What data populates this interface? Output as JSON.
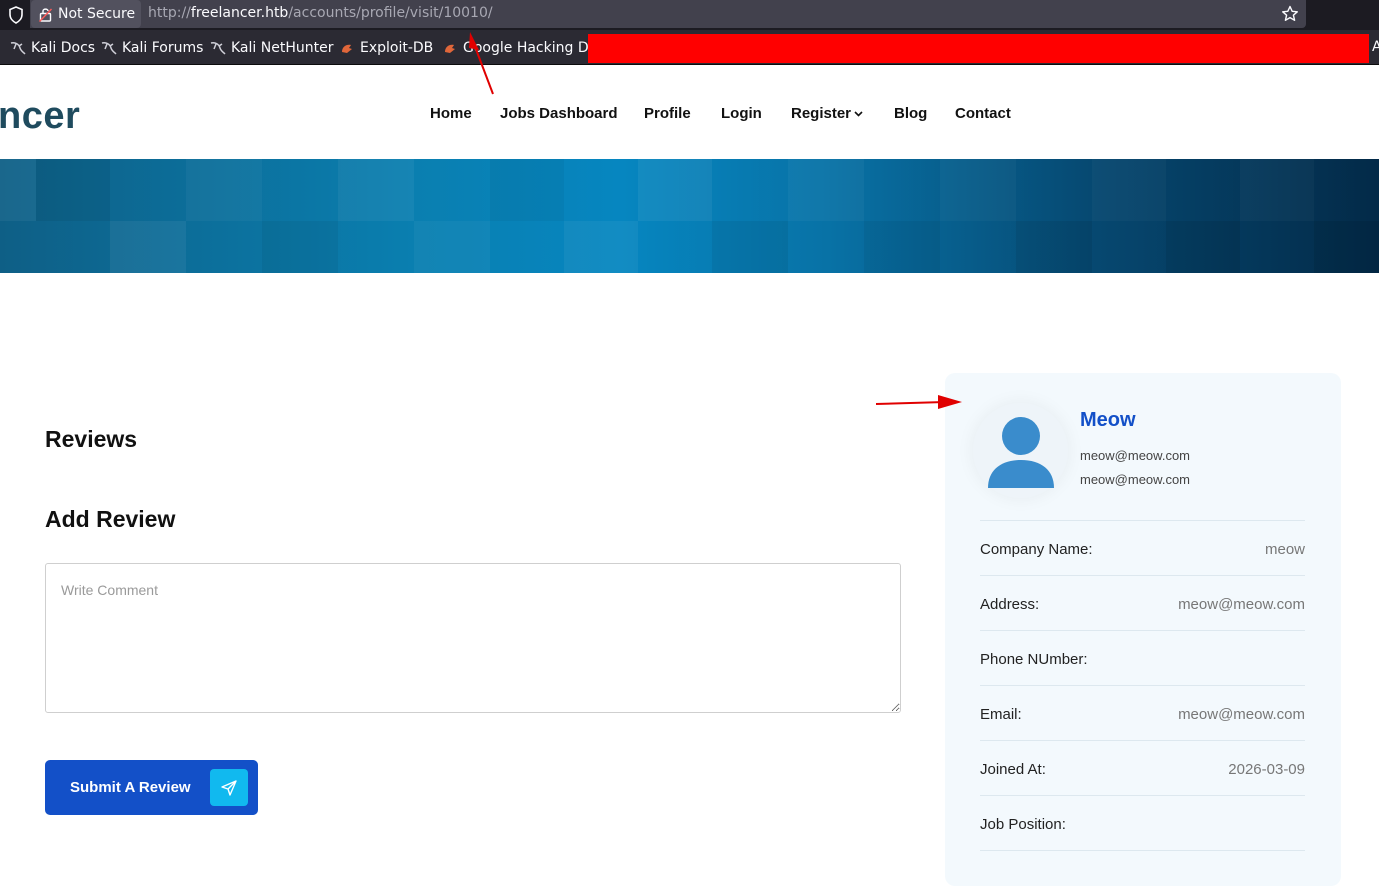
{
  "browser": {
    "security_label": "Not Secure",
    "url_scheme": "http://",
    "url_host": "freelancer.htb",
    "url_path": "/accounts/profile/visit/10010/",
    "bookmarks": [
      {
        "label": "Kali Docs",
        "icon": "kali-dragon-icon"
      },
      {
        "label": "Kali Forums",
        "icon": "kali-dragon-icon"
      },
      {
        "label": "Kali NetHunter",
        "icon": "kali-dragon-icon"
      },
      {
        "label": "Exploit-DB",
        "icon": "exploit-db-icon"
      },
      {
        "label": "Google Hacking DB",
        "icon": "exploit-db-icon"
      }
    ],
    "bookmarks_overflow": "A"
  },
  "site": {
    "logo_text": "ncer",
    "nav": [
      "Home",
      "Jobs Dashboard",
      "Profile",
      "Login",
      "Register",
      "Blog",
      "Contact"
    ]
  },
  "main": {
    "reviews_heading": "Reviews",
    "add_review_heading": "Add Review",
    "comment_placeholder": "Write Comment",
    "submit_label": "Submit A Review"
  },
  "profile": {
    "name": "Meow",
    "email_line_1": "meow@meow.com",
    "email_line_2": "meow@meow.com",
    "rows": [
      {
        "label": "Company Name:",
        "value": "meow"
      },
      {
        "label": "Address:",
        "value": "meow@meow.com"
      },
      {
        "label": "Phone NUmber:",
        "value": ""
      },
      {
        "label": "Email:",
        "value": "meow@meow.com"
      },
      {
        "label": "Joined At:",
        "value": "2026-03-09"
      },
      {
        "label": "Job Position:",
        "value": ""
      }
    ]
  },
  "colors": {
    "accent_blue": "#1350c8",
    "send_icon_bg": "#11b9ef",
    "annotation_red": "#ff0000"
  }
}
